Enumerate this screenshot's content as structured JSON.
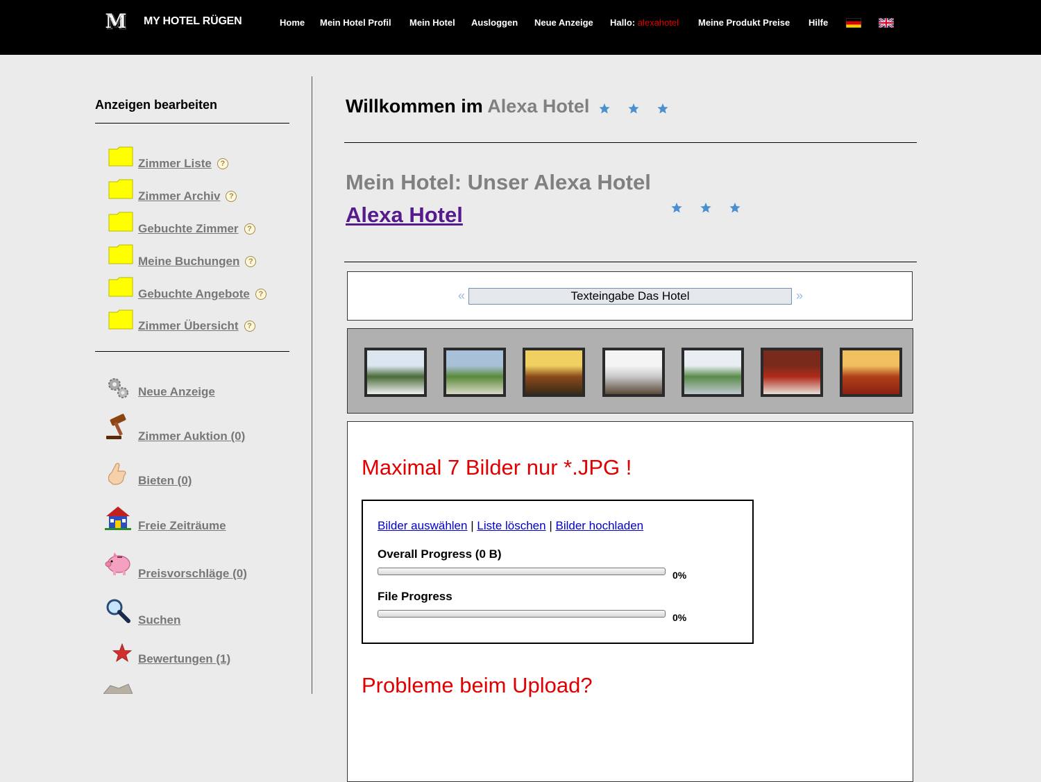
{
  "header": {
    "logo_letter": "M",
    "brand": "MY HOTEL RÜGEN",
    "nav": [
      {
        "label": "Home"
      },
      {
        "label": "Mein Hotel Profil"
      },
      {
        "label": "Mein Hotel"
      },
      {
        "label": "Ausloggen"
      },
      {
        "label": "Neue Anzeige"
      }
    ],
    "greeting": "Hallo:",
    "username": "alexahotel",
    "nav_right": [
      {
        "label": "Meine Produkt Preise"
      },
      {
        "label": "Hilfe"
      }
    ],
    "flags": [
      "german-flag-icon",
      "uk-flag-icon"
    ]
  },
  "sidebar": {
    "title": "Anzeigen bearbeiten",
    "folder_links": [
      {
        "label": "Zimmer Liste",
        "icon": "folder-icon"
      },
      {
        "label": "Zimmer Archiv",
        "icon": "folder-icon"
      },
      {
        "label": "Gebuchte Zimmer",
        "icon": "folder-icon"
      },
      {
        "label": "Meine Buchungen",
        "icon": "folder-icon"
      },
      {
        "label": "Gebuchte Angebote",
        "icon": "folder-icon"
      },
      {
        "label": "Zimmer Übersicht",
        "icon": "folder-icon"
      }
    ],
    "help_glyph": "?",
    "icon_links": [
      {
        "label": "Neue Anzeige",
        "icon": "gears-icon"
      },
      {
        "label": "Zimmer Auktion (0)",
        "icon": "gavel-icon"
      },
      {
        "label": "Bieten (0)",
        "icon": "hand-icon"
      },
      {
        "label": "Freie Zeiträume",
        "icon": "house-icon"
      },
      {
        "label": "Preisvorschläge (0)",
        "icon": "piggy-bank-icon"
      },
      {
        "label": "Suchen",
        "icon": "magnifier-icon"
      },
      {
        "label": "Bewertungen (1)",
        "icon": "star-icon"
      }
    ]
  },
  "main": {
    "welcome_prefix": "Willkommen im",
    "welcome_hotel": "Alexa Hotel",
    "star_rating": 3,
    "subtitle": "Mein Hotel: Unser Alexa Hotel",
    "hotel_link": "Alexa Hotel",
    "text_nav": {
      "prev": "«",
      "button": "Texteingabe Das Hotel",
      "next": "»"
    },
    "thumbnails": [
      {
        "name": "hotel-exterior-photo",
        "colors": [
          "#dce6f0",
          "#4a6b3a",
          "#f0f0f0"
        ]
      },
      {
        "name": "garden-photo",
        "colors": [
          "#a8c0d8",
          "#5a8a3a",
          "#d8d8c8"
        ]
      },
      {
        "name": "lobby-photo",
        "colors": [
          "#f0d060",
          "#8a4a1a",
          "#3a2a1a"
        ]
      },
      {
        "name": "balcony-photo",
        "colors": [
          "#f4f4f4",
          "#c8c8c8",
          "#5a4a3a"
        ]
      },
      {
        "name": "view-photo",
        "colors": [
          "#e8eef4",
          "#5a8a4a",
          "#c0c8d0"
        ]
      },
      {
        "name": "room-photo",
        "colors": [
          "#7a2a1a",
          "#b02a1a",
          "#e8e0d8"
        ]
      },
      {
        "name": "staircase-photo",
        "colors": [
          "#f0c060",
          "#b0401a",
          "#8a2010"
        ]
      }
    ],
    "upload": {
      "max_text": "Maximal 7 Bilder nur *.JPG !",
      "select_link": "Bilder auswählen",
      "separator": "|",
      "clear_link": "Liste löschen",
      "upload_link": "Bilder hochladen",
      "overall_label": "Overall Progress (0 B)",
      "overall_percent": "0%",
      "overall_value": 0,
      "file_label": "File Progress",
      "file_percent": "0%",
      "file_value": 0
    },
    "problem_text": "Probleme beim Upload?"
  },
  "colors": {
    "header_bg": "#000000",
    "page_bg": "#ebebeb",
    "link_gray": "#777777",
    "alert_red": "#e00000",
    "star_blue": "#4a90d0",
    "folder_yellow": "#ffff00"
  }
}
